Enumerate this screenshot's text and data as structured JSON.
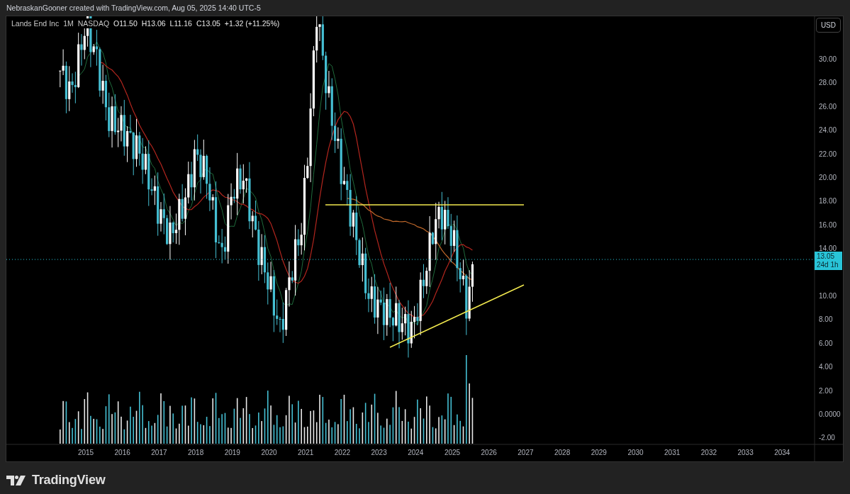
{
  "header": {
    "attribution": "NebraskanGooner created with TradingView.com, Aug 05, 2025 14:40 UTC-5"
  },
  "legend": {
    "symbol": "Lands End Inc",
    "interval": "1M",
    "exchange": "NASDAQ",
    "ohlc": [
      "O11.50",
      "H13.06",
      "L11.16",
      "C13.05"
    ],
    "change": "+1.32 (+11.25%)"
  },
  "currency_button": "USD",
  "price_axis": [
    "30.00",
    "28.00",
    "26.00",
    "24.00",
    "22.00",
    "20.00",
    "18.00",
    "16.00",
    "14.00",
    "10.00",
    "8.00",
    "6.00",
    "4.00",
    "2.00",
    "0.0000",
    "-2.00"
  ],
  "last_price": {
    "price": "13.05",
    "countdown": "24d 1h"
  },
  "time_axis": [
    "2015",
    "2016",
    "2017",
    "2018",
    "2019",
    "2020",
    "2021",
    "2022",
    "2023",
    "2024",
    "2025",
    "2026",
    "2027",
    "2028",
    "2029",
    "2030",
    "2031",
    "2032",
    "2033",
    "2034"
  ],
  "footer": {
    "logo_text": "TradingView"
  }
}
